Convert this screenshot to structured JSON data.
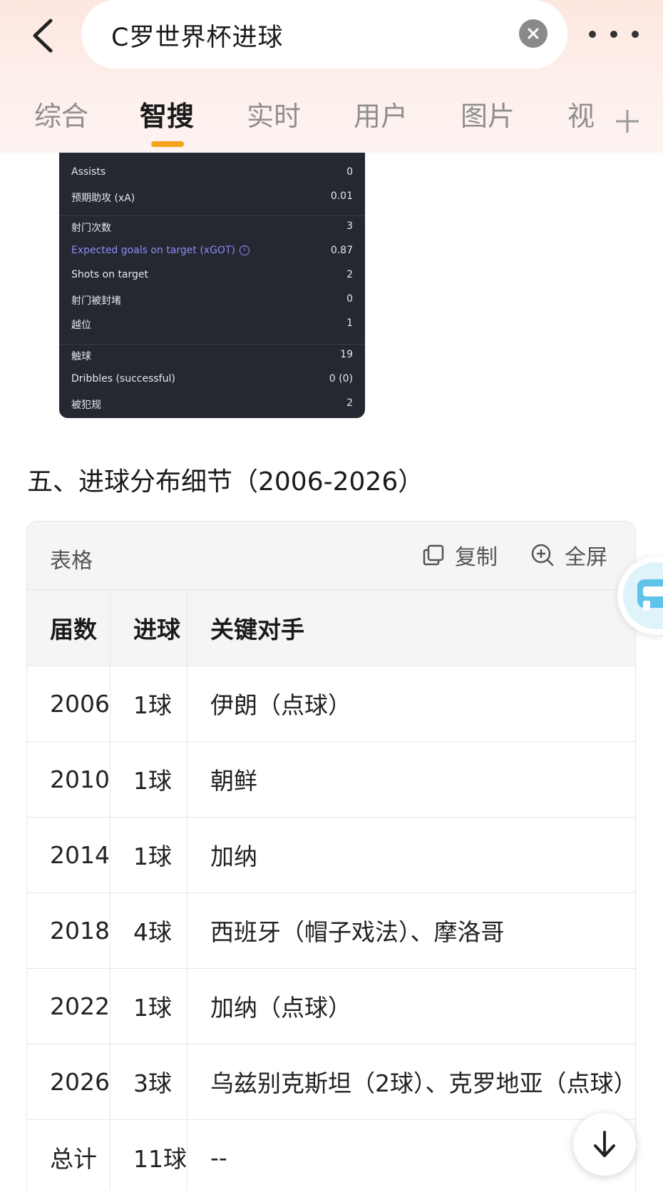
{
  "search": {
    "query": "C罗世界杯进球"
  },
  "tabs": [
    {
      "label": "综合"
    },
    {
      "label": "智搜"
    },
    {
      "label": "实时"
    },
    {
      "label": "用户"
    },
    {
      "label": "图片"
    },
    {
      "label": "视"
    }
  ],
  "stats": {
    "group1": [
      {
        "label": "Assists",
        "value": "0"
      },
      {
        "label": "预期助攻 (xA)",
        "value": "0.01"
      }
    ],
    "group2": [
      {
        "label": "射门次数",
        "value": "3"
      },
      {
        "label": "Expected goals on target (xGOT)",
        "value": "0.87"
      },
      {
        "label": "Shots on target",
        "value": "2"
      },
      {
        "label": "射门被封堵",
        "value": "0"
      },
      {
        "label": "越位",
        "value": "1"
      }
    ],
    "group3": [
      {
        "label": "触球",
        "value": "19"
      },
      {
        "label": "Dribbles (successful)",
        "value": "0 (0)"
      },
      {
        "label": "被犯规",
        "value": "2"
      }
    ]
  },
  "section": {
    "heading": "五、进球分布细节（2006-2026）"
  },
  "table": {
    "toolbar_label": "表格",
    "copy_label": "复制",
    "fullscreen_label": "全屏",
    "headers": [
      "届数",
      "进球",
      "关键对手"
    ],
    "rows": [
      [
        "2006",
        "1球",
        "伊朗（点球）"
      ],
      [
        "2010",
        "1球",
        "朝鲜"
      ],
      [
        "2014",
        "1球",
        "加纳"
      ],
      [
        "2018",
        "4球",
        "西班牙（帽子戏法）、摩洛哥"
      ],
      [
        "2022",
        "1球",
        "加纳（点球）"
      ],
      [
        "2026",
        "3球",
        "乌兹别克斯坦（2球）、克罗地亚（点球）"
      ],
      [
        "总计",
        "11球",
        "--"
      ]
    ]
  },
  "colors": {
    "accent": "#f7a21b",
    "card_bg": "#252731",
    "highlight": "#8b8ff4"
  }
}
